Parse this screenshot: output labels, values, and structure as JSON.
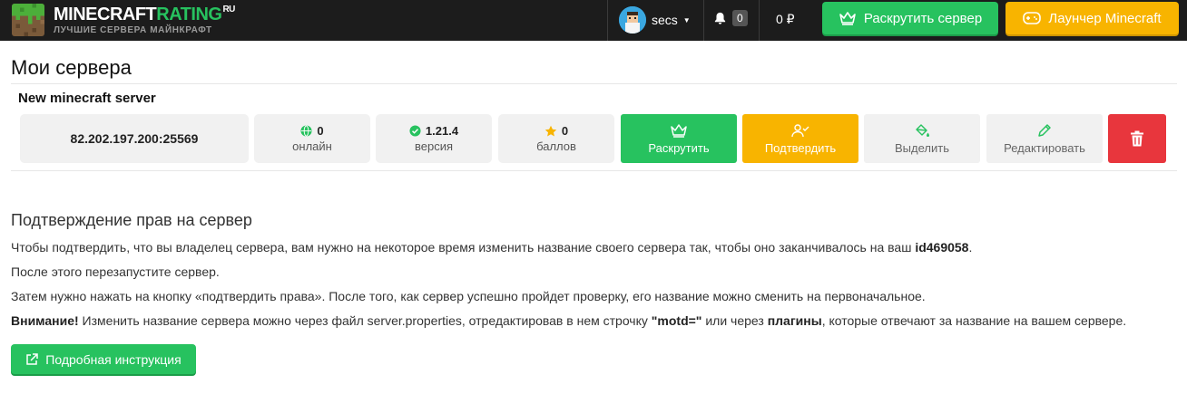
{
  "header": {
    "logo": {
      "name_main": "MINECRAFT",
      "name_accent": "RATING",
      "name_sup": "RU",
      "tagline": "ЛУЧШИЕ СЕРВЕРА МАЙНКРАФТ"
    },
    "user": {
      "name": "secs"
    },
    "notifications": {
      "count": "0"
    },
    "balance": "0 ₽",
    "promote_button": "Раскрутить сервер",
    "launcher_button": "Лаунчер Minecraft",
    "colors": {
      "bar": "#1c1c1c",
      "green": "#27c25f",
      "yellow": "#f8b400"
    },
    "icons": [
      "bell-icon",
      "crown-icon",
      "gamepad-icon"
    ]
  },
  "main": {
    "title": "Мои сервера",
    "server": {
      "name": "New minecraft server",
      "address": "82.202.197.200:25569",
      "stats": [
        {
          "value": "0",
          "label": "онлайн",
          "icon": "globe-icon",
          "color": "#27c25f"
        },
        {
          "value": "1.21.4",
          "label": "версия",
          "icon": "check-circle-icon",
          "color": "#27c25f"
        },
        {
          "value": "0",
          "label": "баллов",
          "icon": "star-icon",
          "color": "#f8b400"
        }
      ],
      "actions": {
        "promote": "Раскрутить",
        "confirm": "Подтвердить",
        "highlight": "Выделить",
        "edit": "Редактировать",
        "delete_color": "#e8363d"
      }
    },
    "verification": {
      "title": "Подтверждение прав на сервер",
      "p1_text": "Чтобы подтвердить, что вы владелец сервера, вам нужно на некоторое время изменить название своего сервера так, чтобы оно заканчивалось на ваш ",
      "p1_id": "id469058",
      "p1_end": ".",
      "p2": "После этого перезапустите сервер.",
      "p3": "Затем нужно нажать на кнопку «подтвердить права». После того, как сервер успешно пройдет проверку, его название можно сменить на первоначальное.",
      "p4_warning": "Внимание!",
      "p4_text1": " Изменить название сервера можно через файл server.properties, отредактировав в нем строчку ",
      "p4_motd": "\"motd=\"",
      "p4_text2": " или через ",
      "p4_plugins": "плагины",
      "p4_text3": ", которые отвечают за название на вашем сервере.",
      "guide_button": "Подробная инструкция"
    }
  }
}
